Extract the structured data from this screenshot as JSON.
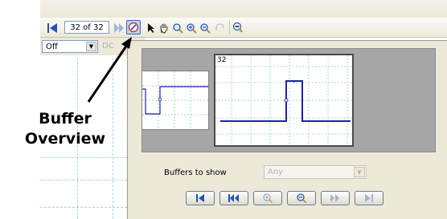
{
  "toolbar": {
    "buffer_counter": "32 of 32",
    "icons": [
      "first-buffer-icon",
      "next-buffer-icon",
      "buffer-overview-icon",
      "select-arrow-icon",
      "hand-icon",
      "zoom-icon",
      "zoom-in-icon",
      "zoom-out-icon",
      "undo-zoom-icon",
      "zoom-full-icon"
    ]
  },
  "trigger": {
    "mode_value": "Off",
    "dc_label": "DC"
  },
  "overview": {
    "current_buffer_label": "32",
    "buffers_to_show_label": "Buffers to show",
    "buffers_to_show_value": "Any",
    "nav_buttons": [
      "first-icon",
      "previous-icon",
      "zoom-in-icon",
      "zoom-out-icon",
      "next-icon",
      "last-icon"
    ]
  },
  "callout": {
    "line1": "Buffer",
    "line2": "Overview"
  },
  "colors": {
    "trace": "#1f1fb0",
    "grid": "#a7d7d4",
    "dialog_bg": "#ece9d8",
    "highlight": "#316ac5"
  }
}
